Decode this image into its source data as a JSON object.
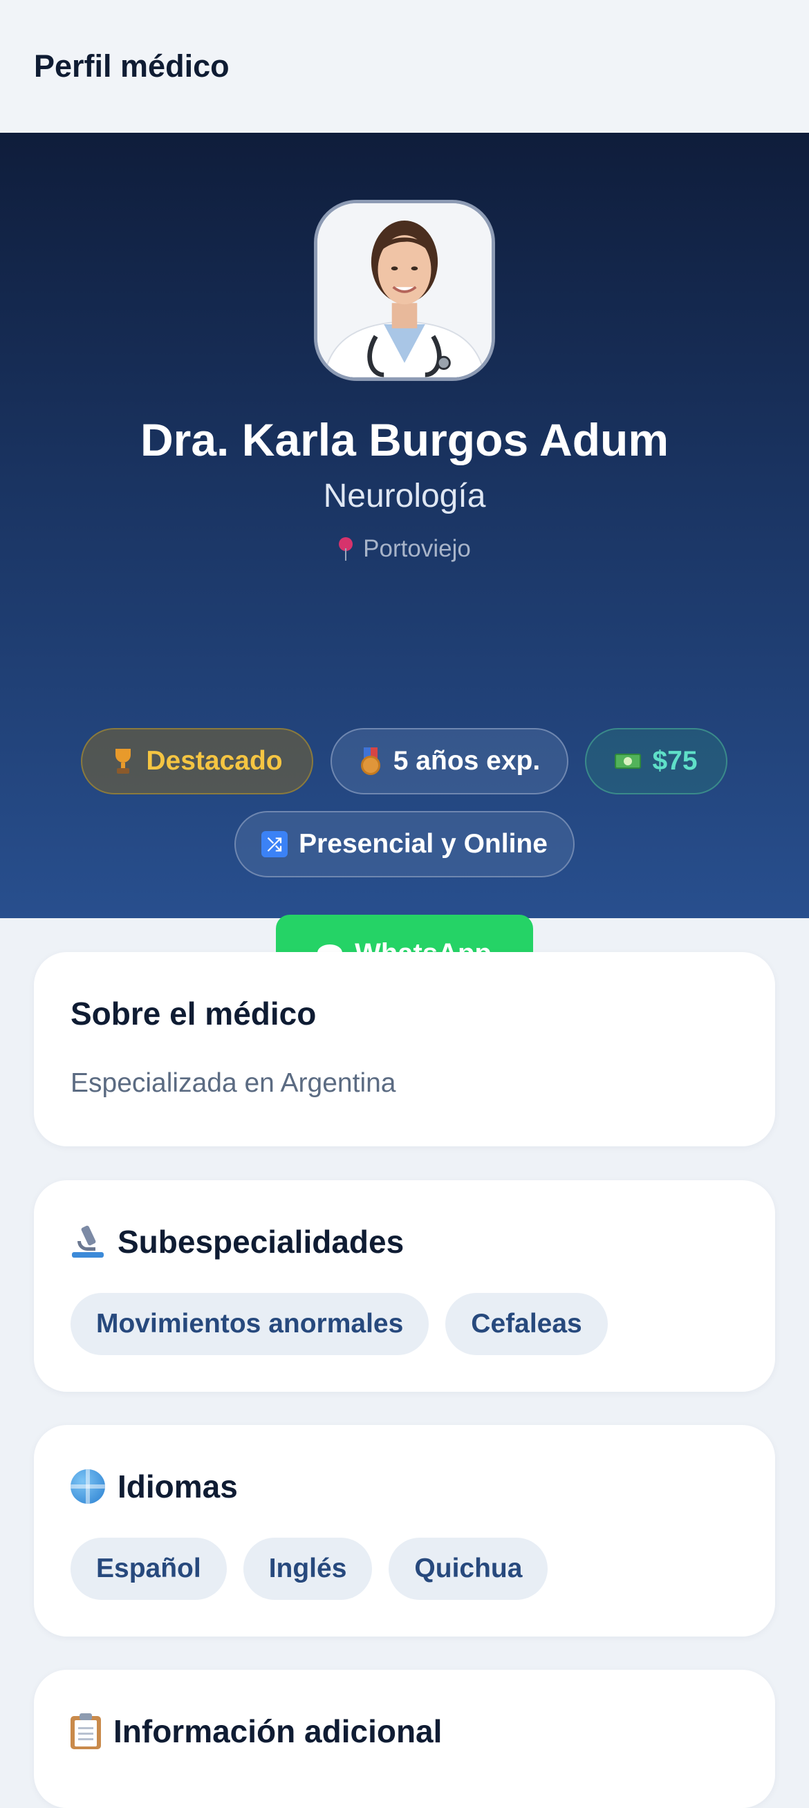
{
  "header": {
    "title": "Perfil médico"
  },
  "profile": {
    "name": "Dra. Karla Burgos Adum",
    "specialty": "Neurología",
    "location": "Portoviejo",
    "badges": {
      "featured": "Destacado",
      "experience": "5 años exp.",
      "price": "$75",
      "mode": "Presencial y Online"
    },
    "whatsapp_label": "WhatsApp"
  },
  "about": {
    "title": "Sobre el médico",
    "text": "Especializada en Argentina"
  },
  "subspecialties": {
    "title": "Subespecialidades",
    "items": [
      "Movimientos anormales",
      "Cefaleas"
    ]
  },
  "languages": {
    "title": "Idiomas",
    "items": [
      "Español",
      "Inglés",
      "Quichua"
    ]
  },
  "additional": {
    "title": "Información adicional"
  },
  "colors": {
    "accent_whatsapp": "#25d366",
    "featured_gold": "#f5c542",
    "price_teal": "#5fe0c8"
  }
}
